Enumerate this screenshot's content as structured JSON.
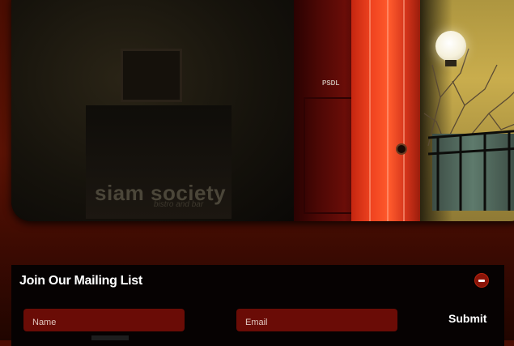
{
  "hero": {
    "sign_text": "siam society",
    "sign_subtext": "bistro and bar",
    "door_label": "PSDL"
  },
  "mailing_list": {
    "title": "Join Our Mailing List",
    "collapse_icon": "minus-circle-icon",
    "name_placeholder": "Name",
    "email_placeholder": "Email",
    "submit_label": "Submit"
  },
  "colors": {
    "page_background": "#4a0d02",
    "panel_background": "#060202",
    "input_background": "#6a0c06",
    "accent": "#8a1408"
  }
}
